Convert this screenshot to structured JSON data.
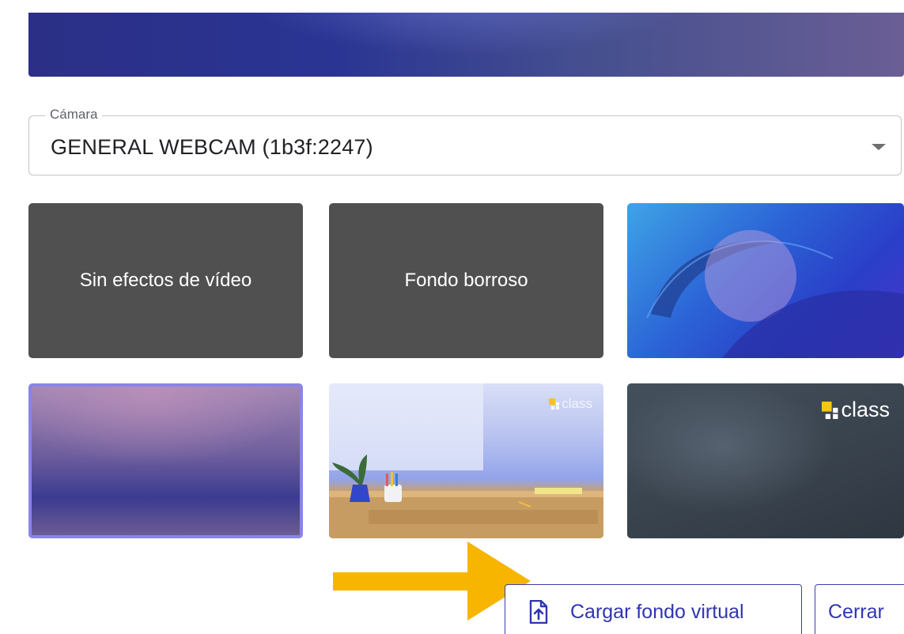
{
  "camera": {
    "label": "Cámara",
    "selected": "GENERAL WEBCAM (1b3f:2247)"
  },
  "effects": {
    "no_effects_label": "Sin efectos de vídeo",
    "blur_label": "Fondo borroso",
    "brand_text": "class"
  },
  "actions": {
    "upload_label": "Cargar fondo virtual",
    "close_label": "Cerrar"
  },
  "colors": {
    "accent": "#2f35b2",
    "selected_border": "#8a84e8",
    "tile_dark": "#505050",
    "arrow": "#f7b500",
    "brand_logo": "#f5c518"
  },
  "icons": [
    "dropdown-arrow-icon",
    "upload-file-icon",
    "annotation-arrow",
    "class-logo-icon"
  ],
  "state": {
    "selected_background_index": 4
  }
}
